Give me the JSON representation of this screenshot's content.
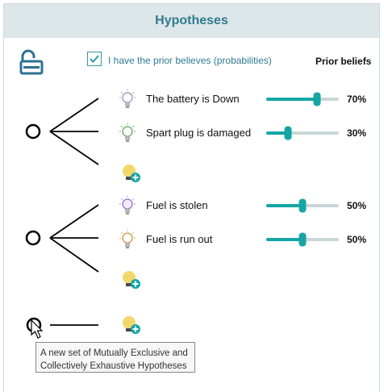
{
  "header": {
    "title": "Hypotheses"
  },
  "controls": {
    "prior_checkbox_label": "I have the prior believes (probabilities)",
    "prior_checked": true,
    "prior_beliefs_label": "Prior beliefs"
  },
  "groups": [
    {
      "hypotheses": [
        {
          "label": "The battery is Down",
          "percent": "70%",
          "value": 0.7
        },
        {
          "label": "Spart plug is damaged",
          "percent": "30%",
          "value": 0.3
        }
      ]
    },
    {
      "hypotheses": [
        {
          "label": "Fuel is stolen",
          "percent": "50%",
          "value": 0.5
        },
        {
          "label": "Fuel is run out",
          "percent": "50%",
          "value": 0.5
        }
      ]
    }
  ],
  "tooltip": {
    "line1": "A new set of Mutually Exclusive and",
    "line2": "Collectively Exhaustive Hypotheses"
  },
  "colors": {
    "accent": "#16a5a5",
    "track": "#c9d6d8",
    "header_text": "#2f7b91",
    "header_bg": "#dde6e9"
  }
}
